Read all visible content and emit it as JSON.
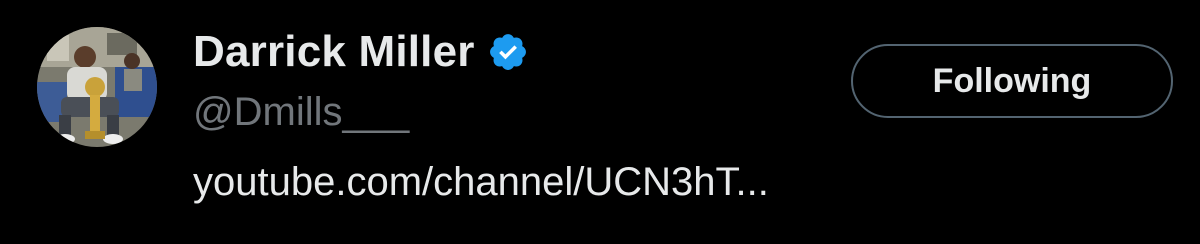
{
  "profile": {
    "display_name": "Darrick Miller",
    "handle": "@Dmills___",
    "verified": true,
    "verified_icon": "verified-badge-icon",
    "bio_link_text": "youtube.com/channel/UCN3hT..."
  },
  "actions": {
    "follow_label": "Following"
  },
  "colors": {
    "background": "#000000",
    "primary_text": "#e7e9ea",
    "secondary_text": "#71767b",
    "verified_blue": "#1d9bf0",
    "button_border": "#536471"
  }
}
